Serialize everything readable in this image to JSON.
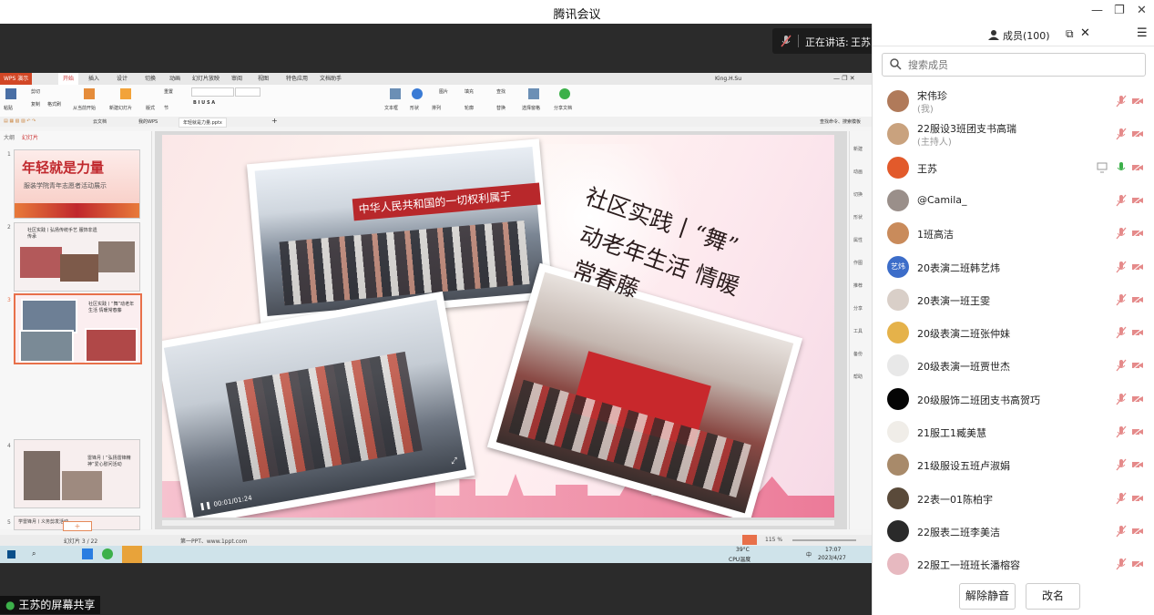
{
  "window": {
    "title": "腾讯会议",
    "minimize": "—",
    "restore": "❐",
    "close": "✕"
  },
  "speaking": {
    "label": "正在讲话:",
    "name": "王苏;"
  },
  "share_label": "王苏的屏幕共享",
  "wps": {
    "logo": "WPS 演示",
    "tabs": [
      "开始",
      "插入",
      "设计",
      "切换",
      "动画",
      "幻灯片放映",
      "审阅",
      "视图",
      "特色应用",
      "文档助手"
    ],
    "active_tab": "开始",
    "user": "King.H.Su",
    "ribbon": [
      "粘贴",
      "剪切",
      "复制",
      "格式刷",
      "从当前开始",
      "新建幻灯片",
      "版式",
      "节",
      "重置",
      "文本框",
      "形状",
      "排列",
      "图片",
      "填充",
      "轮廓",
      "查找",
      "替换",
      "选择窗格",
      "分享文档"
    ],
    "doc_tabs": [
      "云文档",
      "我的WPS",
      "年轻就是力量.pptx"
    ],
    "search_hint": "查找命令、搜索模板",
    "outline_tabs": [
      "大纲",
      "幻灯片"
    ],
    "thumb_numbers": [
      "1",
      "2",
      "3",
      "4",
      "5"
    ],
    "thumb1_title": "年轻就是力量",
    "thumb1_sub": "服装学院青年志愿者活动展示",
    "thumb2_text": "社区实践丨弘扬传统手艺 服饰非遗传承",
    "thumb3_text": "社区实践丨“舞”动老年生活 情暖常春藤",
    "thumb4_text": "雷锋月丨“弘扬雷锋精神”爱心慰问活动",
    "thumb5_text": "学雷锋月丨义务剪发活动",
    "slide_title_lines": [
      "社区实践丨“舞”",
      "动老年生活 情暖",
      "常春藤"
    ],
    "banner_text": "中华人民共和国的一切权利属于",
    "video_time": "00:01/01:24",
    "right_tools": [
      "新建",
      "动画",
      "切换",
      "形状",
      "属性",
      "作图",
      "推荐",
      "分享",
      "工具",
      "备份",
      "帮助"
    ],
    "status_slide": "幻灯片 3 / 22",
    "status_theme": "第一PPT、www.1ppt.com",
    "zoom": "115 %",
    "taskbar": {
      "temp": "39°C",
      "cpu": "CPU温度",
      "ime": "中",
      "time": "17:07",
      "date": "2023/4/27"
    }
  },
  "panel": {
    "tab_members": "成员(100)",
    "search_placeholder": "搜索成员",
    "members": [
      {
        "name": "宋伟珍",
        "sub": "(我)",
        "color": "#b07a5a",
        "unmuted": false
      },
      {
        "name": "22服设3班团支书高瑞",
        "sub": "(主持人)",
        "color": "#c9a27e",
        "unmuted": false
      },
      {
        "name": "王苏",
        "sub": "",
        "color": "#e25a2b",
        "unmuted": true
      },
      {
        "name": "@Camila_",
        "sub": "",
        "color": "#9a8f8a",
        "unmuted": false
      },
      {
        "name": "1班高洁",
        "sub": "",
        "color": "#c98b5b",
        "unmuted": false
      },
      {
        "name": "20表演二班韩艺炜",
        "sub": "",
        "color": "#3c6dc9",
        "avatar_text": "艺炜",
        "unmuted": false
      },
      {
        "name": "20表演一班王雯",
        "sub": "",
        "color": "#d9cfc8",
        "unmuted": false
      },
      {
        "name": "20级表演二班张仲妹",
        "sub": "",
        "color": "#e5b24a",
        "unmuted": false
      },
      {
        "name": "20级表演一班贾世杰",
        "sub": "",
        "color": "#e8e8e8",
        "unmuted": false
      },
      {
        "name": "20级服饰二班团支书高贺巧",
        "sub": "",
        "color": "#050505",
        "unmuted": false
      },
      {
        "name": "21服工1臧美慧",
        "sub": "",
        "color": "#f0ede8",
        "unmuted": false
      },
      {
        "name": "21级服设五班卢淑娟",
        "sub": "",
        "color": "#a88a6a",
        "unmuted": false
      },
      {
        "name": "22表一01陈柏宇",
        "sub": "",
        "color": "#5a4a3a",
        "unmuted": false
      },
      {
        "name": "22服表二班李美洁",
        "sub": "",
        "color": "#2a2a2a",
        "unmuted": false
      },
      {
        "name": "22服工一班班长潘榕容",
        "sub": "",
        "color": "#e7b9c0",
        "unmuted": false
      }
    ],
    "btn_unmute": "解除静音",
    "btn_rename": "改名"
  },
  "colors": {
    "accent": "#e25a2b",
    "unmuted_mic": "#3cb04a",
    "muted_red": "#e58a8a"
  }
}
